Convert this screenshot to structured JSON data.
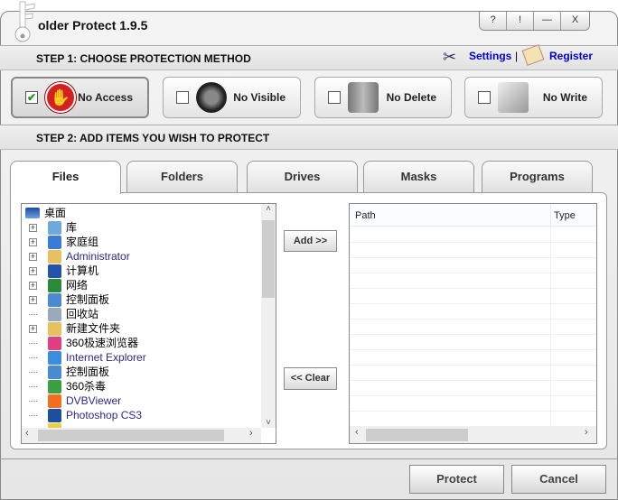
{
  "window": {
    "title": "older Protect 1.9.5",
    "controls": [
      "?",
      "!",
      "—",
      "X"
    ]
  },
  "step1": {
    "label": "STEP 1: CHOOSE PROTECTION METHOD",
    "settings": "Settings",
    "separator": "|",
    "register": "Register"
  },
  "methods": [
    {
      "label": "No Access",
      "checked": true,
      "icon": "stop-hand-icon"
    },
    {
      "label": "No Visible",
      "checked": false,
      "icon": "eye-blocked-icon"
    },
    {
      "label": "No Delete",
      "checked": false,
      "icon": "trash-blocked-icon"
    },
    {
      "label": "No Write",
      "checked": false,
      "icon": "pen-blocked-icon"
    }
  ],
  "step2": {
    "label": "STEP 2: ADD ITEMS YOU WISH TO PROTECT"
  },
  "tabs": [
    {
      "label": "Files",
      "active": true
    },
    {
      "label": "Folders"
    },
    {
      "label": "Drives"
    },
    {
      "label": "Masks"
    },
    {
      "label": "Programs"
    }
  ],
  "tree": {
    "root": "桌面",
    "items": [
      {
        "label": "库",
        "expand": true,
        "color": "#000",
        "icon": "#6fa8dc"
      },
      {
        "label": "家庭组",
        "expand": true,
        "color": "#000",
        "icon": "#3a7bd5"
      },
      {
        "label": "Administrator",
        "expand": true,
        "color": "#2b2b8a",
        "icon": "#e8c060"
      },
      {
        "label": "计算机",
        "expand": true,
        "color": "#000",
        "icon": "#2255aa"
      },
      {
        "label": "网络",
        "expand": true,
        "color": "#000",
        "icon": "#2a8a3a"
      },
      {
        "label": "控制面板",
        "expand": true,
        "color": "#000",
        "icon": "#4a8ad0"
      },
      {
        "label": "回收站",
        "expand": false,
        "color": "#000",
        "icon": "#9ab"
      },
      {
        "label": "新建文件夹",
        "expand": true,
        "color": "#000",
        "icon": "#e8c060"
      },
      {
        "label": "360极速浏览器",
        "expand": false,
        "color": "#000",
        "icon": "#e04080"
      },
      {
        "label": "Internet Explorer",
        "expand": false,
        "color": "#2b2b8a",
        "icon": "#3a8ee0"
      },
      {
        "label": "控制面板",
        "expand": false,
        "color": "#000",
        "icon": "#4a8ad0"
      },
      {
        "label": "360杀毒",
        "expand": false,
        "color": "#000",
        "icon": "#3aa040"
      },
      {
        "label": "DVBViewer",
        "expand": false,
        "color": "#2b2b8a",
        "icon": "#f07020"
      },
      {
        "label": "Photoshop CS3",
        "expand": false,
        "color": "#2b2b8a",
        "icon": "#1f4e9a"
      },
      {
        "label": "",
        "expand": false,
        "color": "#2b2b8a",
        "icon": "#e8d040"
      }
    ]
  },
  "add_button": "Add >>",
  "clear_button": "<< Clear",
  "list": {
    "columns": [
      "Path",
      "Type"
    ]
  },
  "footer": {
    "protect": "Protect",
    "cancel": "Cancel"
  }
}
